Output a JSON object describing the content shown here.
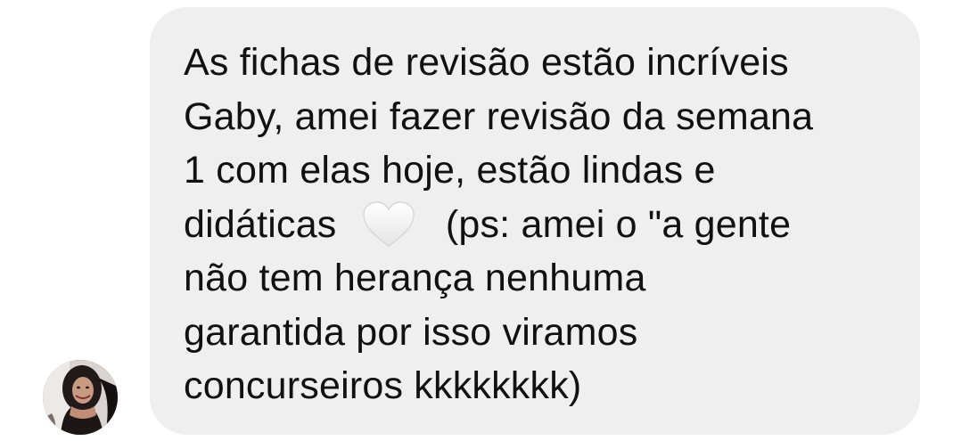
{
  "conversation": {
    "message": {
      "lines": [
        "As fichas de revisão estão incríveis",
        "Gaby, amei fazer revisão da semana",
        "1 com elas hoje, estão lindas e",
        "didáticas",
        "(ps: amei o \"a gente",
        "não tem herança nenhuma",
        "garantida por isso viramos",
        "concurseiros kkkkkkkk)"
      ],
      "emoji": "white-heart-icon"
    },
    "sender_avatar": "profile-photo"
  },
  "colors": {
    "bubble_background": "#efefef",
    "text": "#111111",
    "page_background": "#ffffff"
  }
}
